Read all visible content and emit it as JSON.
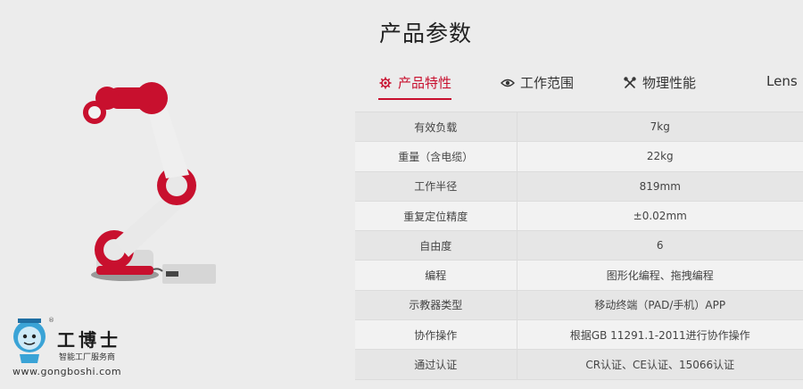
{
  "page_title": "产品参数",
  "tabs": [
    {
      "label": "产品特性",
      "icon": "gear-icon",
      "active": true
    },
    {
      "label": "工作范围",
      "icon": "eye-icon",
      "active": false
    },
    {
      "label": "物理性能",
      "icon": "tools-icon",
      "active": false
    },
    {
      "label": "Lens",
      "icon": "",
      "active": false
    }
  ],
  "specs": [
    {
      "key": "有效负载",
      "value": "7kg"
    },
    {
      "key": "重量（含电缆）",
      "value": "22kg"
    },
    {
      "key": "工作半径",
      "value": "819mm"
    },
    {
      "key": "重复定位精度",
      "value": "±0.02mm"
    },
    {
      "key": "自由度",
      "value": "6"
    },
    {
      "key": "编程",
      "value": "图形化编程、拖拽编程"
    },
    {
      "key": "示教器类型",
      "value": "移动终端（PAD/手机）APP"
    },
    {
      "key": "协作操作",
      "value": "根据GB 11291.1-2011进行协作操作"
    },
    {
      "key": "通过认证",
      "value": "CR认证、CE认证、15066认证"
    }
  ],
  "watermark": {
    "name": "工博士",
    "subtitle": "智能工厂服务商",
    "url": "www.gongboshi.com",
    "registered": "®"
  },
  "colors": {
    "accent": "#c8102e",
    "background": "#ececec"
  }
}
